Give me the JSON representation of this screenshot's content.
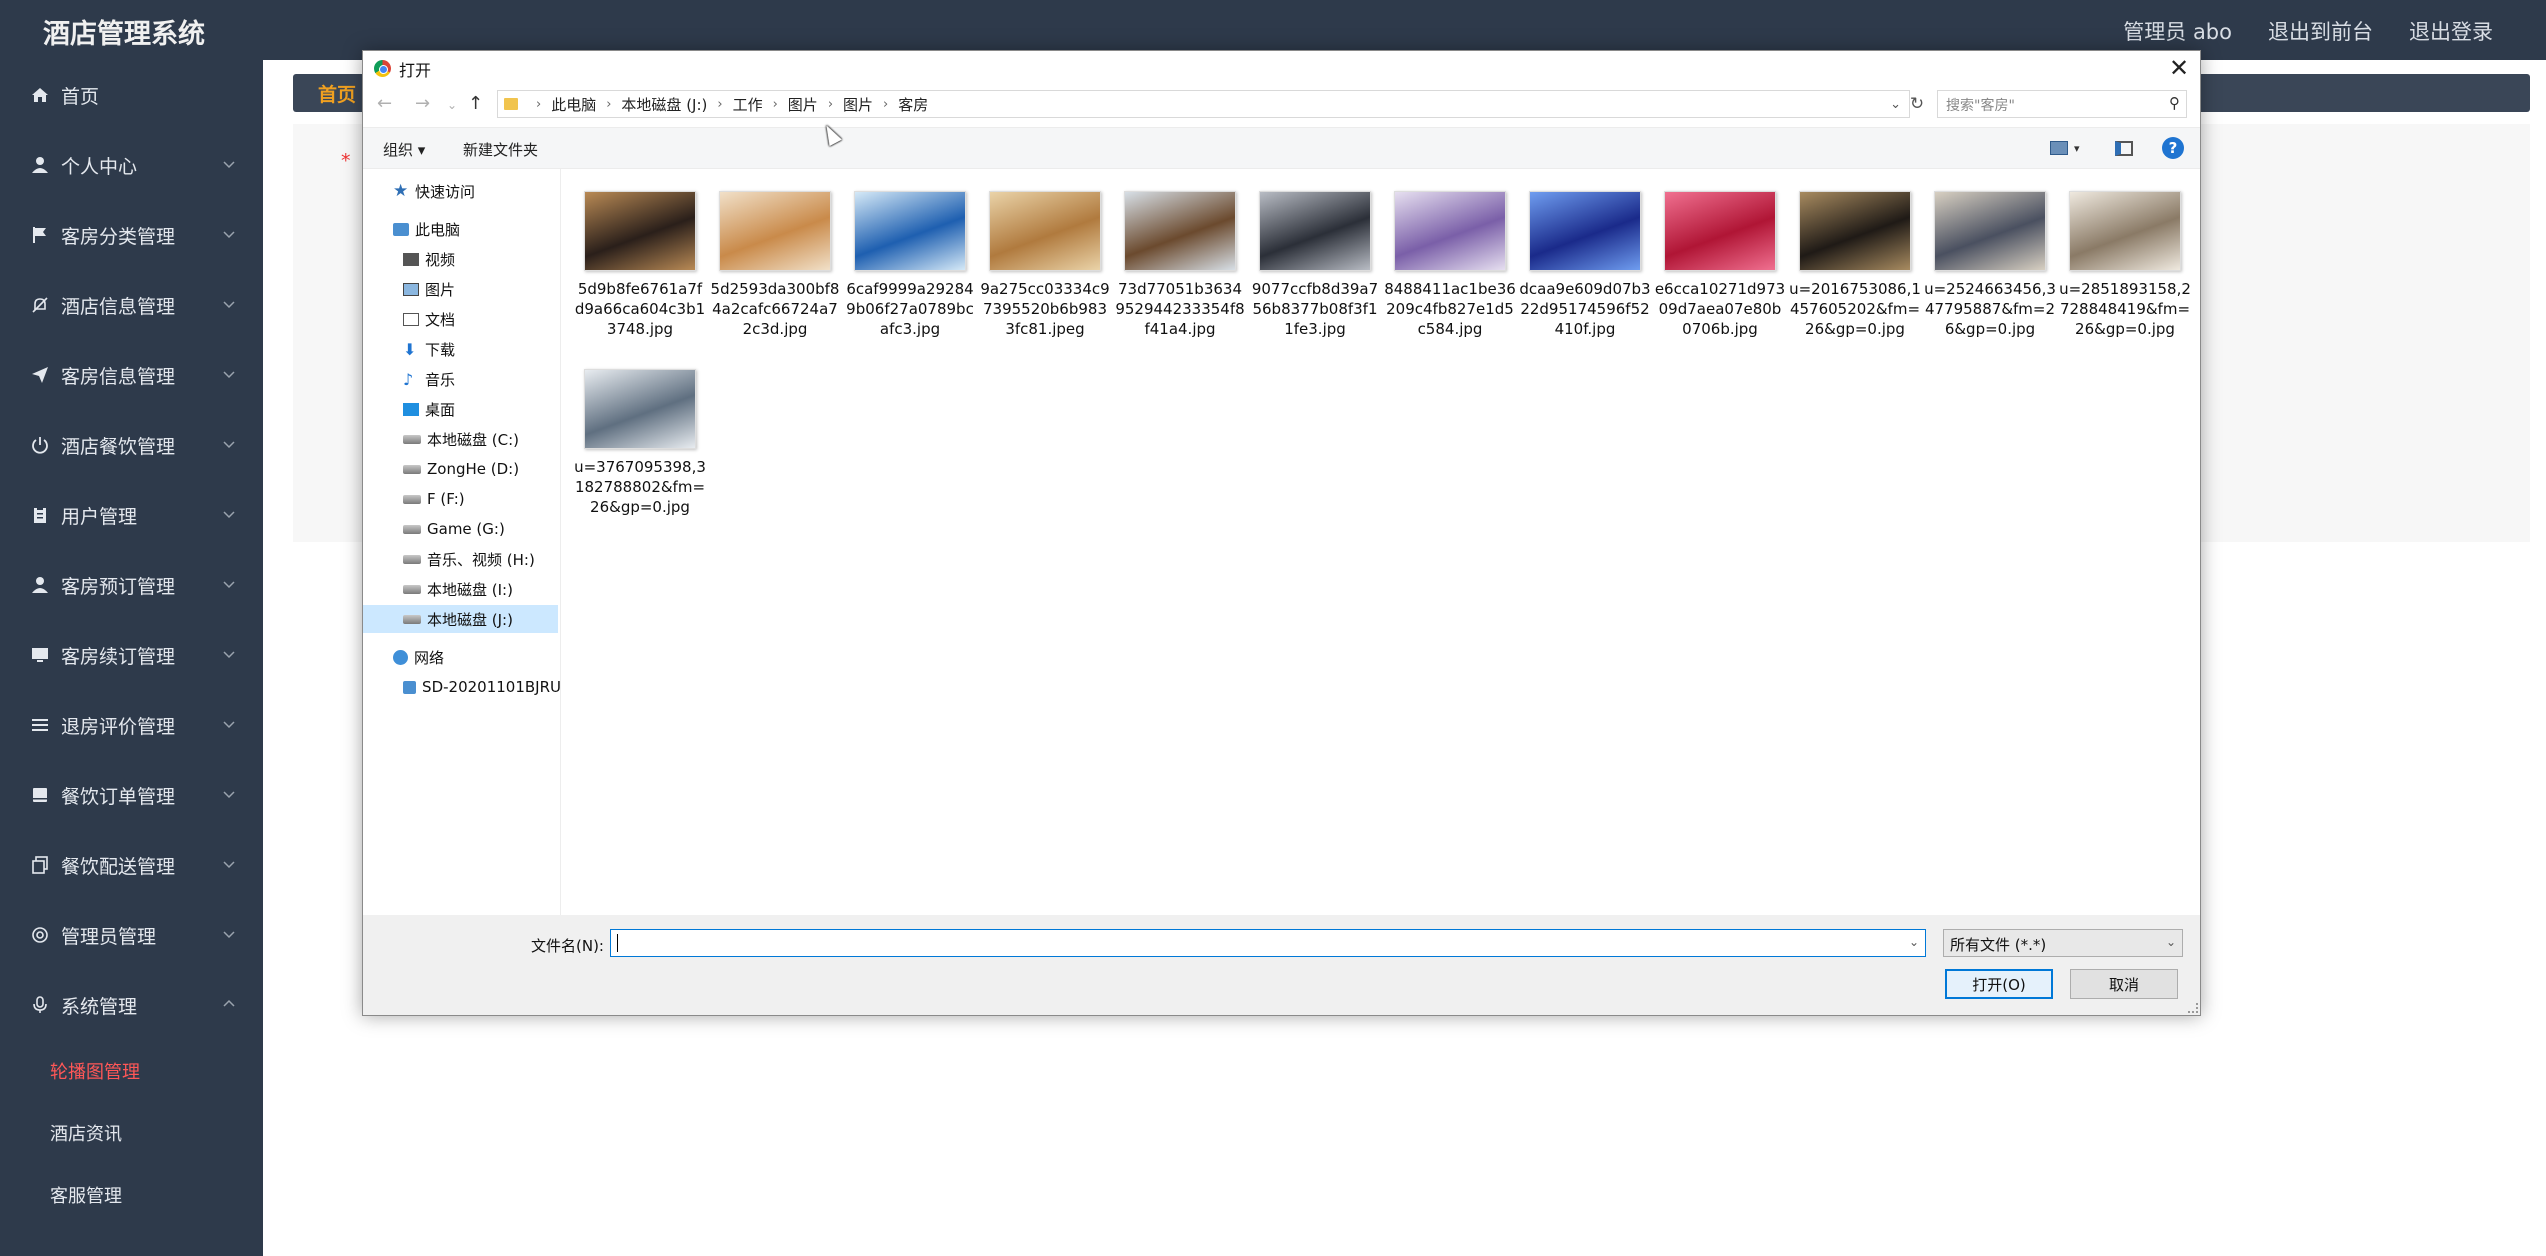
{
  "app": {
    "brand": "酒店管理系统",
    "top_links": [
      "管理员 abo",
      "退出到前台",
      "退出登录"
    ],
    "sidebar": {
      "items": [
        {
          "label": "首页",
          "icon": "home-icon"
        },
        {
          "label": "个人中心",
          "icon": "user-icon"
        },
        {
          "label": "客房分类管理",
          "icon": "flag-icon"
        },
        {
          "label": "酒店信息管理",
          "icon": "bell-slash-icon"
        },
        {
          "label": "客房信息管理",
          "icon": "send-icon"
        },
        {
          "label": "酒店餐饮管理",
          "icon": "power-icon"
        },
        {
          "label": "用户管理",
          "icon": "clipboard-icon"
        },
        {
          "label": "客房预订管理",
          "icon": "user-icon"
        },
        {
          "label": "客房续订管理",
          "icon": "monitor-icon"
        },
        {
          "label": "退房评价管理",
          "icon": "list-icon"
        },
        {
          "label": "餐饮订单管理",
          "icon": "book-icon"
        },
        {
          "label": "餐饮配送管理",
          "icon": "copy-icon"
        },
        {
          "label": "管理员管理",
          "icon": "gear-icon"
        },
        {
          "label": "系统管理",
          "icon": "mic-icon"
        }
      ],
      "sub_items": [
        "轮播图管理",
        "酒店资讯",
        "客服管理"
      ]
    },
    "home_tab": "首页",
    "required_mark": "*"
  },
  "dialog": {
    "title": "打开",
    "close": "✕",
    "breadcrumb": [
      "此电脑",
      "本地磁盘 (J:)",
      "工作",
      "图片",
      "图片",
      "客房"
    ],
    "search_placeholder": "搜索\"客房\"",
    "toolbar": {
      "organize": "组织 ▾",
      "new_folder": "新建文件夹",
      "help": "?"
    },
    "tree": {
      "quick_access": "快速访问",
      "this_pc": "此电脑",
      "items": [
        "视频",
        "图片",
        "文档",
        "下载",
        "音乐",
        "桌面"
      ],
      "drives": [
        "本地磁盘 (C:)",
        "ZongHe (D:)",
        "F (F:)",
        "Game (G:)",
        "音乐、视频 (H:)",
        "本地磁盘 (I:)",
        "本地磁盘 (J:)"
      ],
      "network": "网络",
      "network_pc": "SD-20201101BJRU"
    },
    "files": [
      {
        "name": "5d9b8fe6761a7fd9a66ca604c3b13748.jpg",
        "c1": "#2a1f1a",
        "c2": "#b98a55"
      },
      {
        "name": "5d2593da300bf84a2cafc66724a72c3d.jpg",
        "c1": "#c98a4a",
        "c2": "#f1e0c8"
      },
      {
        "name": "6caf9999a292849b06f27a0789bcafc3.jpg",
        "c1": "#1e5fb0",
        "c2": "#d5e9f7"
      },
      {
        "name": "9a275cc03334c97395520b6b9833fc81.jpeg",
        "c1": "#b07a3e",
        "c2": "#ead3a8"
      },
      {
        "name": "73d77051b3634952944233354f8f41a4.jpg",
        "c1": "#6b4a2e",
        "c2": "#d7dfe6"
      },
      {
        "name": "9077ccfb8d39a756b8377b08f3f11fe3.jpg",
        "c1": "#2b2f38",
        "c2": "#b8bcc4"
      },
      {
        "name": "8488411ac1be36209c4fb827e1d5c584.jpg",
        "c1": "#7a5fa8",
        "c2": "#e6dff0"
      },
      {
        "name": "dcaa9e609d07b322d95174596f52410f.jpg",
        "c1": "#1a2a8a",
        "c2": "#6f9df0"
      },
      {
        "name": "e6cca10271d97309d7aea07e80b0706b.jpg",
        "c1": "#b01535",
        "c2": "#f07090"
      },
      {
        "name": "u=2016753086,1457605202&fm=26&gp=0.jpg",
        "c1": "#1f1a16",
        "c2": "#a88b60"
      },
      {
        "name": "u=2524663456,347795887&fm=26&gp=0.jpg",
        "c1": "#4a5060",
        "c2": "#d8d0c2"
      },
      {
        "name": "u=2851893158,2728848419&fm=26&gp=0.jpg",
        "c1": "#8a7a66",
        "c2": "#efe9df"
      },
      {
        "name": "u=3767095398,3182788802&fm=26&gp=0.jpg",
        "c1": "#5f6f80",
        "c2": "#e8ecf0"
      }
    ],
    "filename_label": "文件名(N):",
    "filename_value": "",
    "filetype": "所有文件 (*.*)",
    "open_btn": "打开(O)",
    "cancel_btn": "取消"
  }
}
